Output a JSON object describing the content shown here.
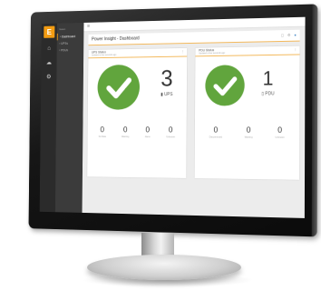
{
  "app": {
    "nav_header": "Eaton",
    "nav_items": [
      "Dashboard",
      "UPSs",
      "PDUs"
    ],
    "page_title": "Power Insight - Dashboard"
  },
  "ups_card": {
    "title": "UPS Status",
    "subtitle": "Updated a few seconds ago",
    "count": "3",
    "count_label": "UPS",
    "stats": [
      {
        "value": "0",
        "label": "No Data"
      },
      {
        "value": "0",
        "label": "Warning"
      },
      {
        "value": "0",
        "label": "Alarm"
      },
      {
        "value": "0",
        "label": "Unknown"
      }
    ]
  },
  "pdu_card": {
    "title": "PDU Status",
    "subtitle": "Updated a few seconds ago",
    "count": "1",
    "count_label": "PDU",
    "stats": [
      {
        "value": "0",
        "label": "Disconnected"
      },
      {
        "value": "0",
        "label": "Warning"
      },
      {
        "value": "0",
        "label": "Unknown"
      }
    ]
  },
  "colors": {
    "accent": "#f39c12",
    "ok_green": "#61a53d",
    "sidebar": "#2b2b2b"
  },
  "icons": [
    "menu-icon",
    "check-icon",
    "gear-icon",
    "home-icon",
    "ups-icon",
    "pdu-icon"
  ]
}
